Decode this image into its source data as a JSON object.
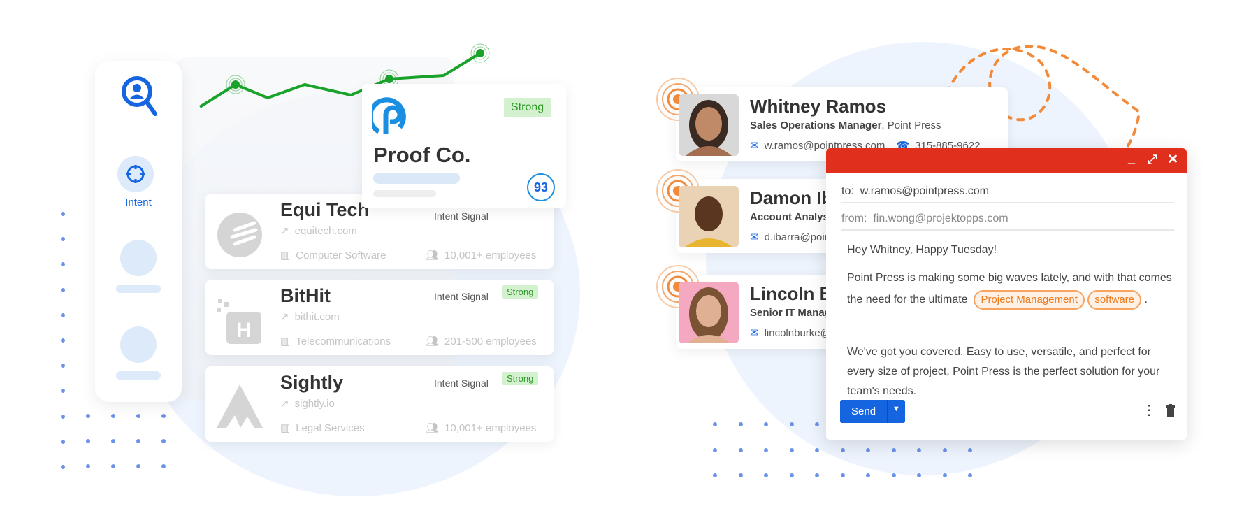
{
  "colors": {
    "accent_blue": "#1565e0",
    "green": "#1aa32a",
    "orange": "#f28a3a",
    "email_header": "#e02f1c"
  },
  "sidebar": {
    "logo_icon": "magnifier-person-icon",
    "items": [
      {
        "label": "Intent",
        "icon": "crosshair-icon"
      }
    ]
  },
  "featured": {
    "name": "Proof Co.",
    "badge": "Strong",
    "score": "93"
  },
  "companies": [
    {
      "name": "Equi Tech",
      "signal_label": "Intent Signal",
      "badge": "",
      "website": "equitech.com",
      "industry": "Computer Software",
      "employees": "10,001+ employees"
    },
    {
      "name": "BitHit",
      "signal_label": "Intent Signal",
      "badge": "Strong",
      "website": "bithit.com",
      "industry": "Telecommunications",
      "employees": "201-500 employees"
    },
    {
      "name": "Sightly",
      "signal_label": "Intent Signal",
      "badge": "Strong",
      "website": "sightly.io",
      "industry": "Legal Services",
      "employees": "10,001+ employees"
    }
  ],
  "people": [
    {
      "name": "Whitney Ramos",
      "title": "Sales Operations Manager",
      "company": "Point Press",
      "email": "w.ramos@pointpress.com",
      "phone": "315-885-9622"
    },
    {
      "name": "Damon Ibarra",
      "title": "Account Analyst",
      "company": "",
      "email": "d.ibarra@pointpress.com",
      "phone": ""
    },
    {
      "name": "Lincoln Burke",
      "title": "Senior IT Manager",
      "company": "",
      "email": "lincolnburke@pointpress.com",
      "phone": ""
    }
  ],
  "email": {
    "to_label": "to:",
    "to": "w.ramos@pointpress.com",
    "from_label": "from:",
    "from": "fin.wong@projektopps.com",
    "greeting": "Hey Whitney, Happy Tuesday!",
    "p1_start": "Point Press is making some big waves lately, and with that comes the need for the ultimate",
    "tag1": "Project Management",
    "tag2": "software",
    "p1_end": ".",
    "p2": "We've got you covered. Easy to use, versatile, and perfect for every size of project, Point Press is the perfect solution for your team's needs.",
    "send": "Send"
  }
}
